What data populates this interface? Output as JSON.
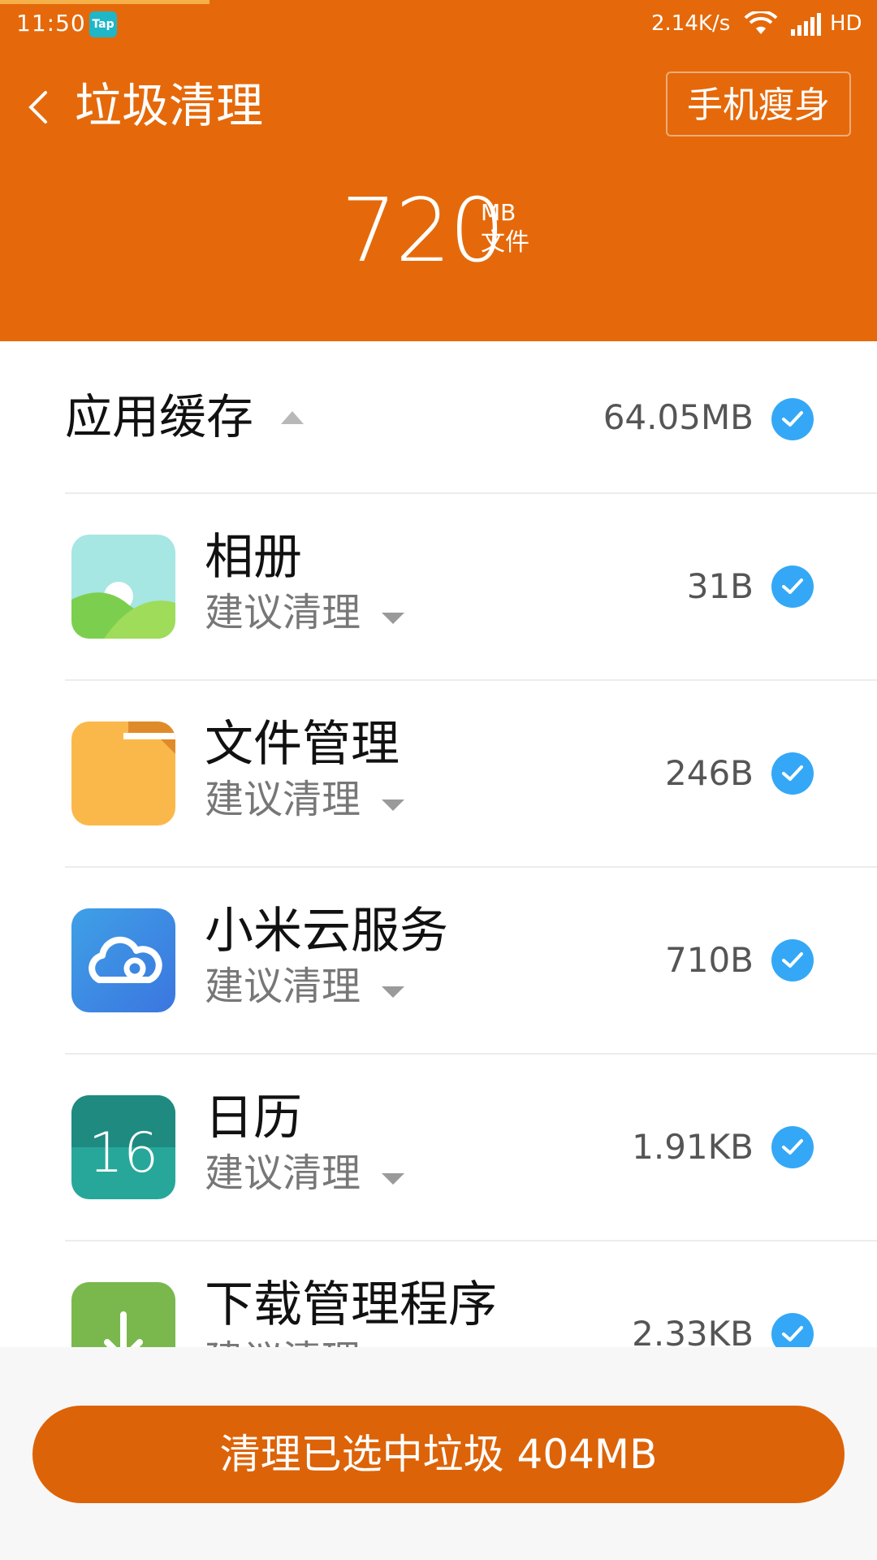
{
  "status_bar": {
    "time": "11:50",
    "app_badge": "Tap",
    "net_speed": "2.14K/s",
    "network_type": "HD"
  },
  "header": {
    "title": "垃圾清理",
    "slim_button": "手机瘦身",
    "total_value": "720",
    "total_unit": "MB",
    "total_label": "文件",
    "bg_color": "#e5690a"
  },
  "section": {
    "title": "应用缓存",
    "size": "64.05MB",
    "checked": true
  },
  "items": [
    {
      "name": "相册",
      "sub": "建议清理",
      "size": "31B",
      "icon": "gallery-icon",
      "checked": true
    },
    {
      "name": "文件管理",
      "sub": "建议清理",
      "size": "246B",
      "icon": "folder-icon",
      "checked": true
    },
    {
      "name": "小米云服务",
      "sub": "建议清理",
      "size": "710B",
      "icon": "cloud-icon",
      "checked": true
    },
    {
      "name": "日历",
      "sub": "建议清理",
      "size": "1.91KB",
      "icon": "calendar-icon",
      "icon_text": "16",
      "checked": true
    },
    {
      "name": "下载管理程序",
      "sub": "建议清理",
      "size": "2.33KB",
      "icon": "download-icon",
      "checked": true
    }
  ],
  "bottom": {
    "clean_button": "清理已选中垃圾 404MB"
  },
  "colors": {
    "accent": "#e5690a",
    "check": "#34a8f6",
    "button": "#dd6308"
  }
}
